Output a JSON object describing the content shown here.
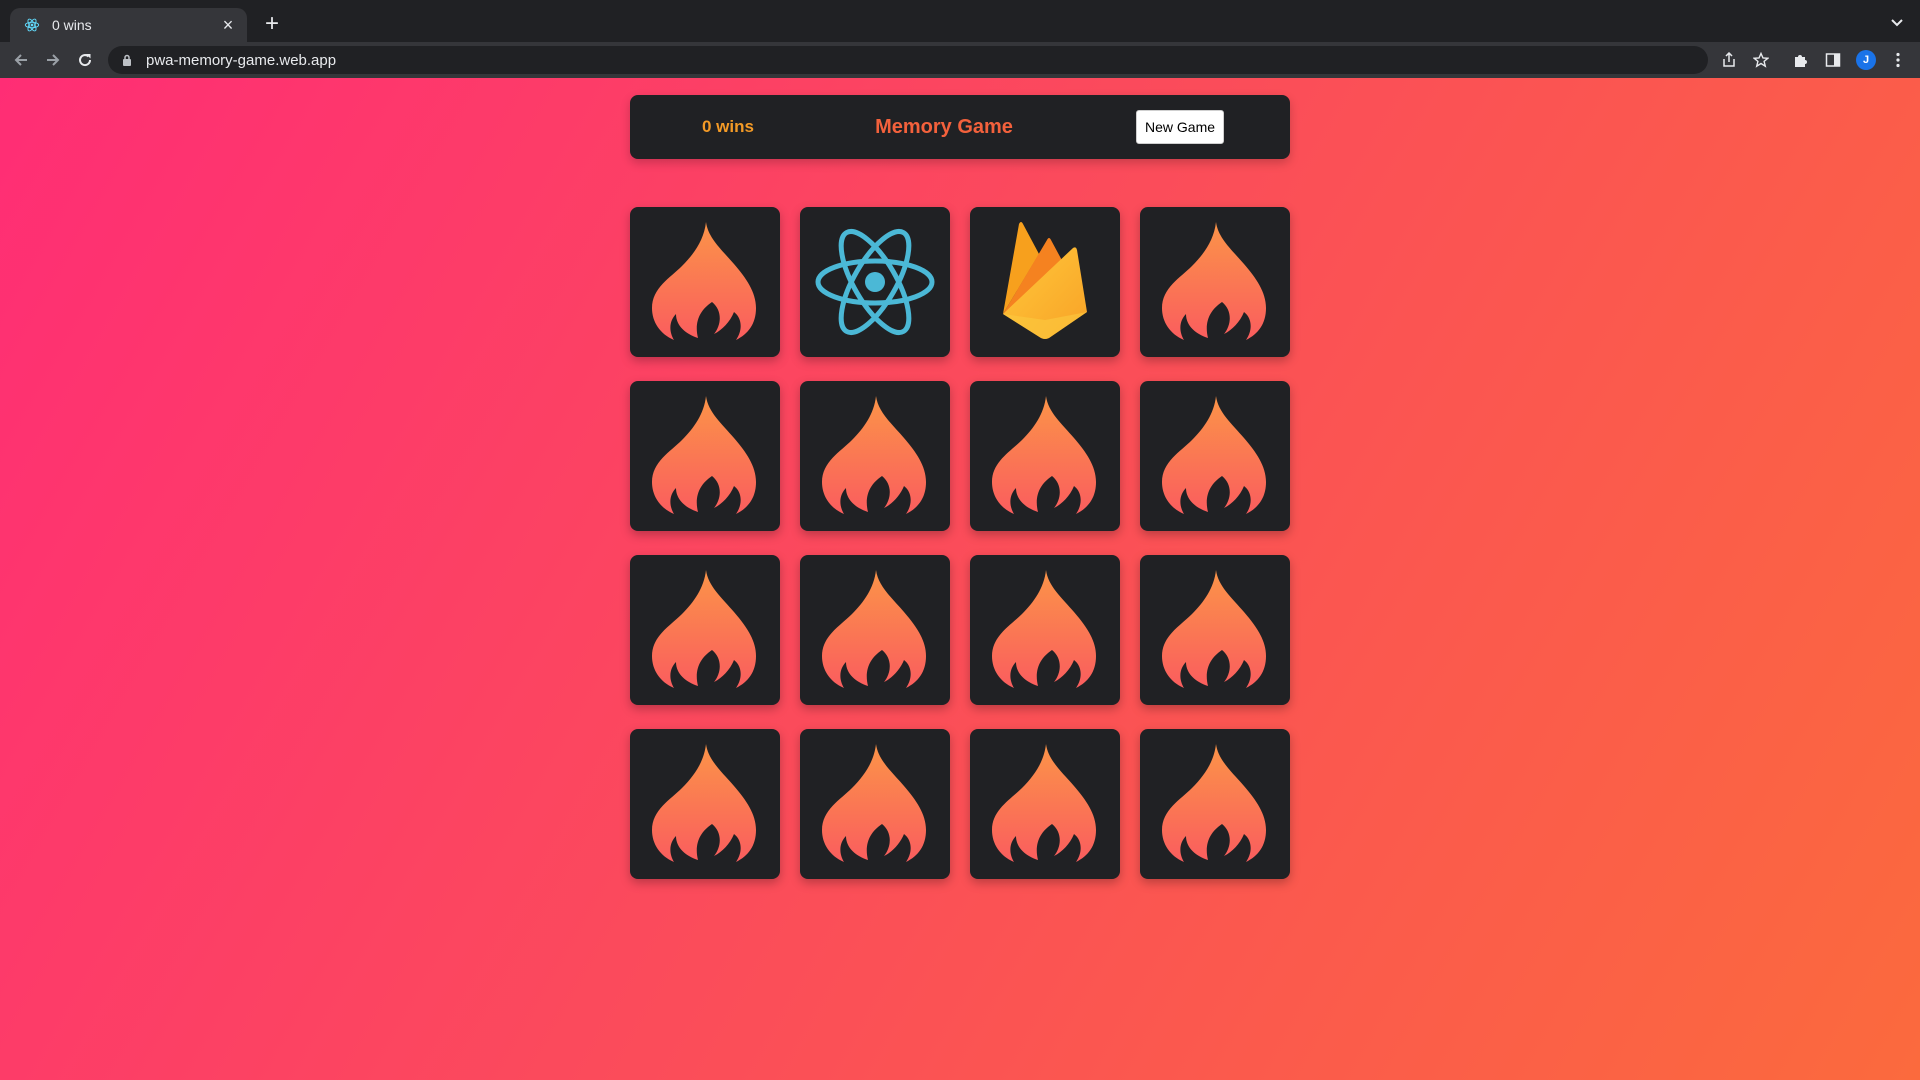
{
  "browser": {
    "tab_title": "0 wins",
    "url": "pwa-memory-game.web.app",
    "profile_initial": "J"
  },
  "header": {
    "wins_text": "0 wins",
    "title": "Memory Game",
    "new_game_label": "New Game"
  },
  "colors": {
    "gradient_start": "#ff2d75",
    "gradient_end": "#fb6a3d",
    "card_bg": "#202124",
    "wins_color": "#f39a26",
    "title_color": "#f3613c",
    "react_blue": "#4bb8d6"
  },
  "board": {
    "rows": 4,
    "columns": 4,
    "cards": [
      {
        "face": "flame-icon"
      },
      {
        "face": "react-icon"
      },
      {
        "face": "firebase-icon"
      },
      {
        "face": "flame-icon"
      },
      {
        "face": "flame-icon"
      },
      {
        "face": "flame-icon"
      },
      {
        "face": "flame-icon"
      },
      {
        "face": "flame-icon"
      },
      {
        "face": "flame-icon"
      },
      {
        "face": "flame-icon"
      },
      {
        "face": "flame-icon"
      },
      {
        "face": "flame-icon"
      },
      {
        "face": "flame-icon"
      },
      {
        "face": "flame-icon"
      },
      {
        "face": "flame-icon"
      },
      {
        "face": "flame-icon"
      }
    ]
  }
}
